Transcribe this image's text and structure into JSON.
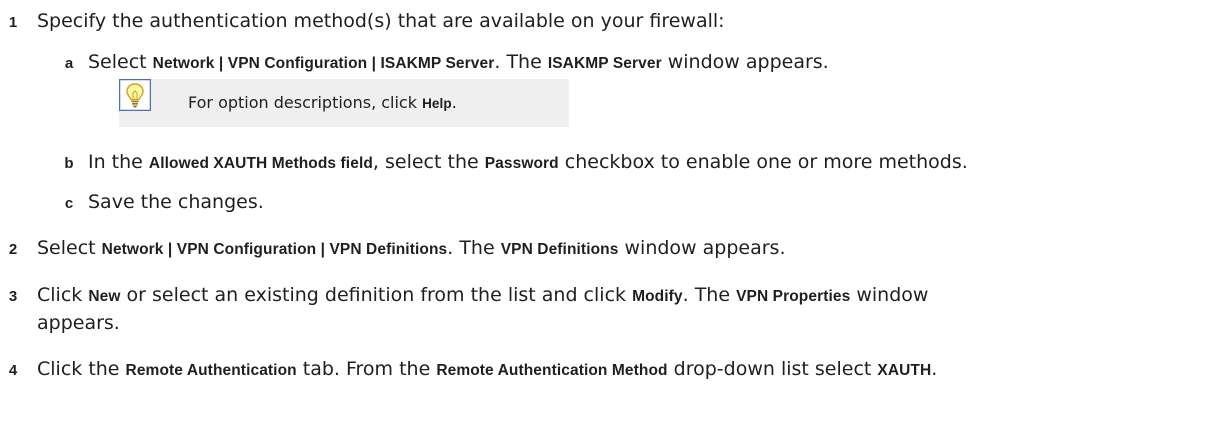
{
  "steps": {
    "s1": {
      "num": "1",
      "text": "Specify the authentication method(s) that are available on your firewall:"
    },
    "s1a": {
      "num": "a",
      "t1": "Select ",
      "b1": "Network | VPN Configuration | ISAKMP Server",
      "t2": ". The ",
      "b2": "ISAKMP Server",
      "t3": " window appears."
    },
    "tip": {
      "icon": "lightbulb-icon",
      "t1": "For option descriptions, click ",
      "b1": "Help",
      "t2": "."
    },
    "s1b": {
      "num": "b",
      "t1": "In the ",
      "b1": "Allowed XAUTH Methods field",
      "t2": ", select the ",
      "b2": "Password",
      "t3": " checkbox to enable one or more methods."
    },
    "s1c": {
      "num": "c",
      "text": "Save the changes."
    },
    "s2": {
      "num": "2",
      "t1": "Select ",
      "b1": "Network | VPN Configuration | VPN Definitions",
      "t2": ". The ",
      "b2": "VPN Definitions",
      "t3": " window appears."
    },
    "s3": {
      "num": "3",
      "t1": "Click ",
      "b1": "New",
      "t2": " or select an existing definition from the list and click ",
      "b2": "Modify",
      "t3": ". The ",
      "b3": "VPN Properties",
      "t4": " window",
      "line2": "appears."
    },
    "s4": {
      "num": "4",
      "t1": "Click the ",
      "b1": "Remote Authentication",
      "t2": " tab. From the ",
      "b2": "Remote Authentication Method",
      "t3": " drop-down list select ",
      "b3": "XAUTH",
      "t4": "."
    }
  },
  "colors": {
    "text": "#1f1f1f",
    "tip_bg": "#efefef",
    "bulb_border": "#4a6fb5",
    "bulb_fill": "#fff7a0"
  }
}
